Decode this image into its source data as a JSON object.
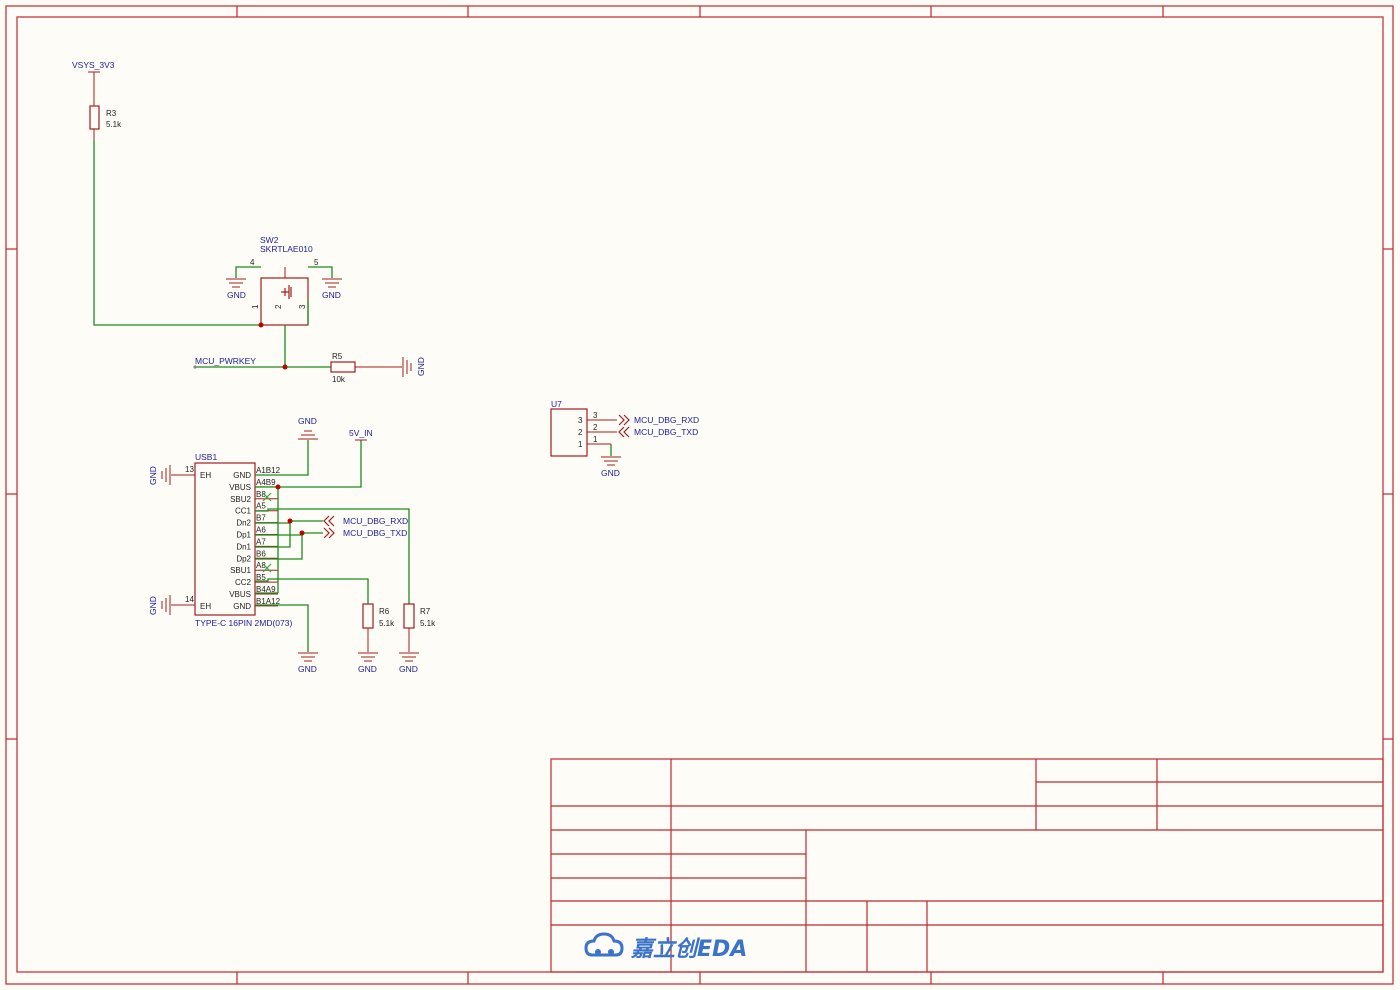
{
  "power": {
    "vsys": "VSYS_3V3",
    "v5in": "5V_IN",
    "gnd": "GND"
  },
  "r3": {
    "ref": "R3",
    "value": "5.1k"
  },
  "r5": {
    "ref": "R5",
    "value": "10k"
  },
  "r6": {
    "ref": "R6",
    "value": "5.1k"
  },
  "r7": {
    "ref": "R7",
    "value": "5.1k"
  },
  "sw2": {
    "ref": "SW2",
    "part": "SKRTLAE010",
    "pins": [
      "1",
      "2",
      "3",
      "4",
      "5"
    ]
  },
  "nets": {
    "pwrkey": "MCU_PWRKEY",
    "rxd": "MCU_DBG_RXD",
    "txd": "MCU_DBG_TXD"
  },
  "u7": {
    "ref": "U7",
    "pins": [
      "3",
      "2",
      "1"
    ]
  },
  "usb1": {
    "ref": "USB1",
    "part": "TYPE-C 16PIN 2MD(073)",
    "left_labels": [
      "EH",
      "EH"
    ],
    "left_pins": [
      "13",
      "14"
    ],
    "inner_labels": [
      "GND",
      "VBUS",
      "SBU2",
      "CC1",
      "Dn2",
      "Dp1",
      "Dn1",
      "Dp2",
      "SBU1",
      "CC2",
      "VBUS",
      "GND"
    ],
    "pin_labels": [
      "A1B12",
      "A4B9",
      "B8",
      "A5",
      "B7",
      "A6",
      "A7",
      "B6",
      "A8",
      "B5",
      "B4A9",
      "B1A12"
    ]
  },
  "title_block": {
    "logo_text": "嘉立创EDA"
  }
}
